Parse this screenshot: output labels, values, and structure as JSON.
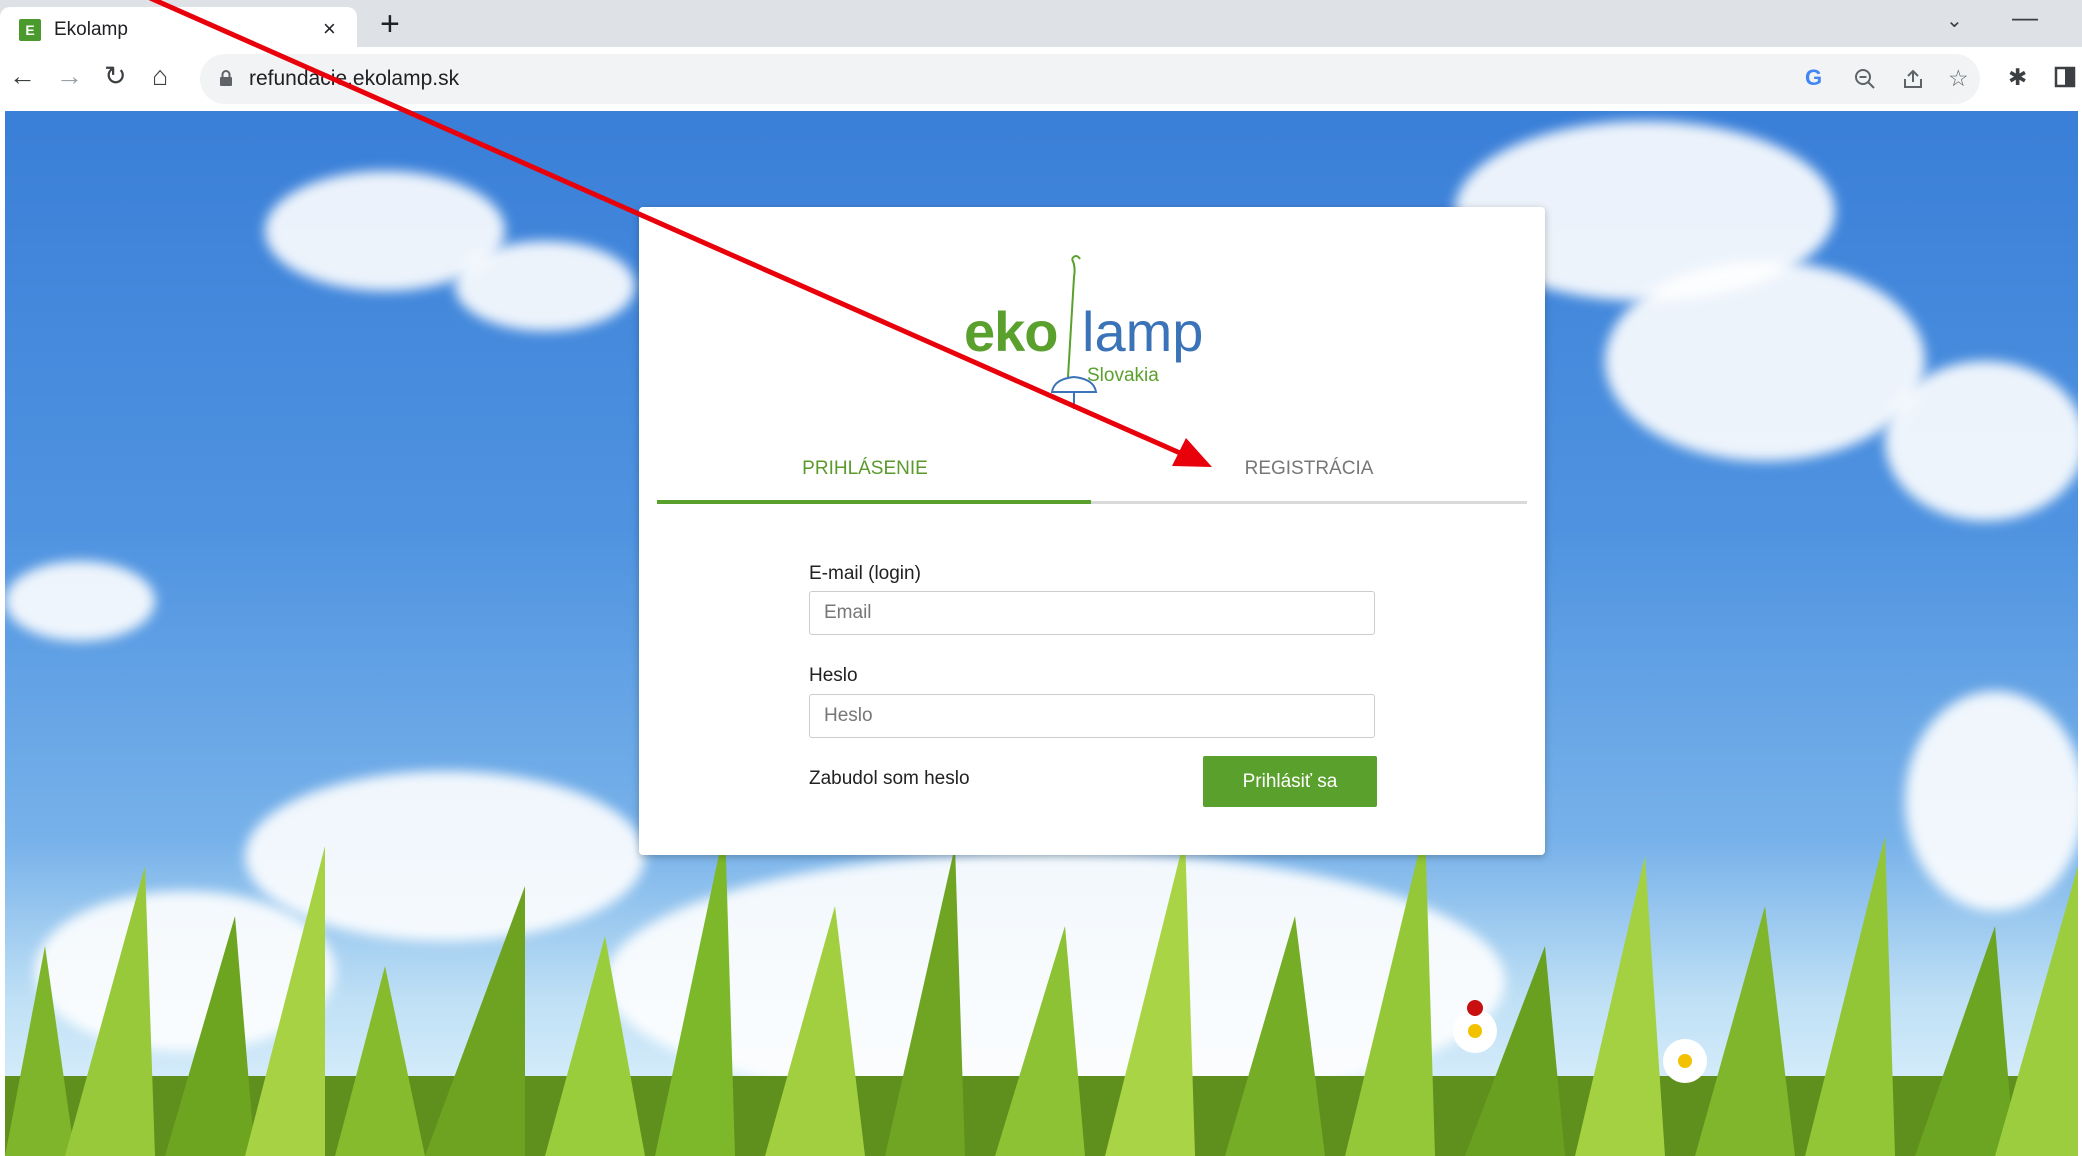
{
  "browser": {
    "tab_title": "Ekolamp",
    "tab_close": "×",
    "new_tab": "+",
    "url": "refundacie.ekolamp.sk",
    "google_icon": "G"
  },
  "logo": {
    "eko": "eko",
    "lamp": "lamp",
    "region": "Slovakia"
  },
  "tabs": {
    "login": "PRIHLÁSENIE",
    "register": "REGISTRÁCIA"
  },
  "form": {
    "email_label": "E-mail (login)",
    "email_placeholder": "Email",
    "password_label": "Heslo",
    "password_placeholder": "Heslo",
    "forgot_link": "Zabudol som heslo",
    "submit_label": "Prihlásiť sa"
  },
  "colors": {
    "accent_green": "#5aa02c",
    "logo_blue": "#3b73b9",
    "annotation_arrow": "#e8000b"
  }
}
